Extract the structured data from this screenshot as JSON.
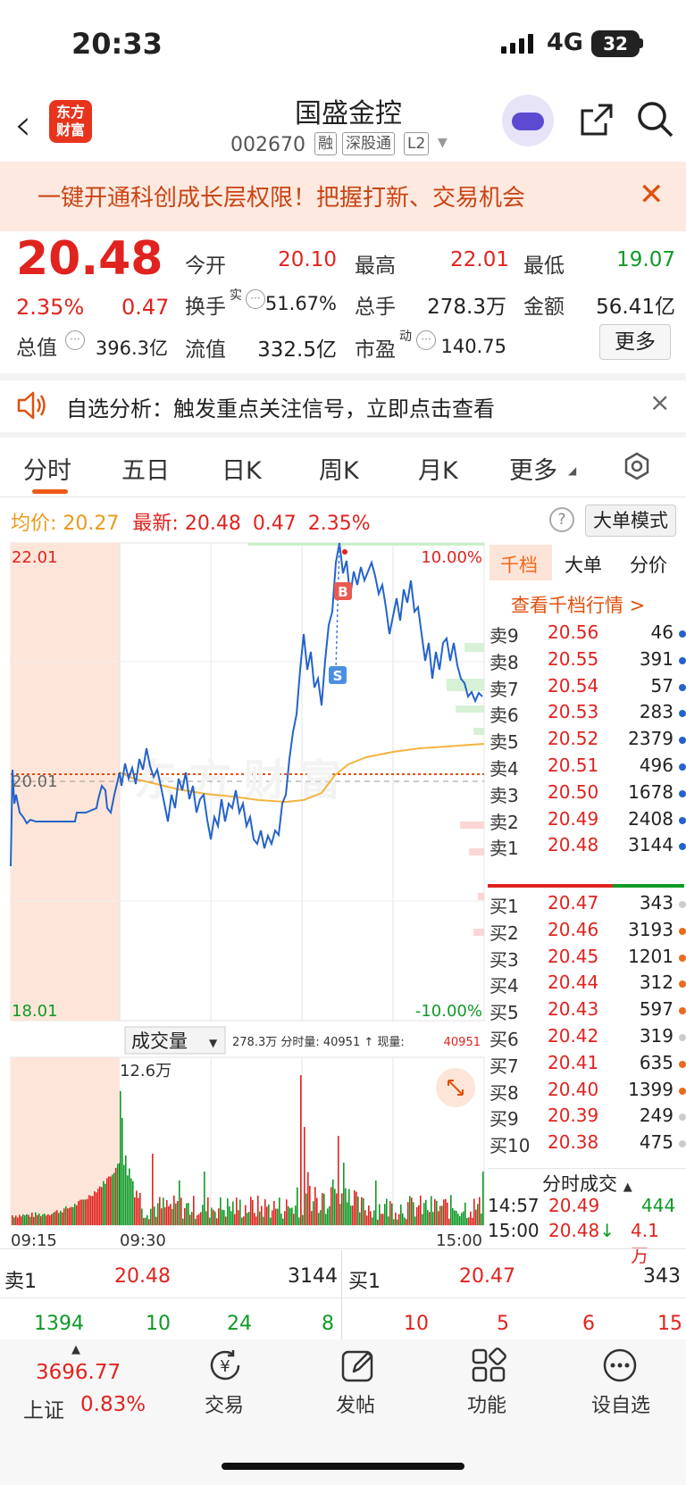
{
  "status": {
    "time": "20:33",
    "network": "4G",
    "battery": "32"
  },
  "header": {
    "logo_text_1": "东方",
    "logo_text_2": "财富",
    "name": "国盛金控",
    "code": "002670",
    "tags": [
      "融",
      "深股通",
      "L2"
    ]
  },
  "banner": {
    "text": "一键开通科创成长层权限！把握打新、交易机会"
  },
  "quote": {
    "price": "20.48",
    "pct": "2.35%",
    "change": "0.47",
    "open_label": "今开",
    "open": "20.10",
    "high_label": "最高",
    "high": "22.01",
    "low_label": "最低",
    "low": "19.07",
    "turnover_label": "换手",
    "turnover_sup": "实",
    "turnover": "51.67%",
    "volume_label": "总手",
    "volume": "278.3万",
    "amount_label": "金额",
    "amount": "56.41亿",
    "mktcap_label": "总值",
    "mktcap": "396.3亿",
    "float_label": "流值",
    "float": "332.5亿",
    "pe_label": "市盈",
    "pe_sup": "动",
    "pe": "140.75",
    "more_label": "更多"
  },
  "alert": {
    "text": "自选分析：触发重点关注信号，立即点击查看"
  },
  "tabs": [
    "分时",
    "五日",
    "日K",
    "周K",
    "月K",
    "更多"
  ],
  "chart_info": {
    "avg_label": "均价:",
    "avg": "20.27",
    "latest_label": "最新:",
    "latest": "20.48",
    "latest_change": "0.47",
    "latest_pct": "2.35%",
    "mode_button": "大单模式"
  },
  "chart_data": {
    "type": "line",
    "y_top": "22.01",
    "y_mid": "20.01",
    "y_bottom": "18.01",
    "pct_top": "10.00%",
    "pct_bottom": "-10.00%",
    "ylim": [
      18.01,
      22.01
    ],
    "markers": [
      "B",
      "S"
    ],
    "volume_selector": "成交量",
    "volume_info": "278.3万 分时量: 40951 ↑ 现量:",
    "volume_now": "40951",
    "volume_max": "12.6万",
    "x_labels": [
      "09:15",
      "09:30",
      "15:00"
    ]
  },
  "orderbook": {
    "tabs": [
      "千档",
      "大单",
      "分价"
    ],
    "link": "查看千档行情 >",
    "sells": [
      {
        "label": "卖9",
        "price": "20.56",
        "vol": "46",
        "dot": "#2563c9"
      },
      {
        "label": "卖8",
        "price": "20.55",
        "vol": "391",
        "dot": "#2563c9"
      },
      {
        "label": "卖7",
        "price": "20.54",
        "vol": "57",
        "dot": "#2563c9"
      },
      {
        "label": "卖6",
        "price": "20.53",
        "vol": "283",
        "dot": "#2563c9"
      },
      {
        "label": "卖5",
        "price": "20.52",
        "vol": "2379",
        "dot": "#2563c9"
      },
      {
        "label": "卖4",
        "price": "20.51",
        "vol": "496",
        "dot": "#2563c9"
      },
      {
        "label": "卖3",
        "price": "20.50",
        "vol": "1678",
        "dot": "#2563c9"
      },
      {
        "label": "卖2",
        "price": "20.49",
        "vol": "2408",
        "dot": "#2563c9"
      },
      {
        "label": "卖1",
        "price": "20.48",
        "vol": "3144",
        "dot": "#2563c9"
      }
    ],
    "buys": [
      {
        "label": "买1",
        "price": "20.47",
        "vol": "343",
        "dot": "#cccccc"
      },
      {
        "label": "买2",
        "price": "20.46",
        "vol": "3193",
        "dot": "#ee6a1c"
      },
      {
        "label": "买3",
        "price": "20.45",
        "vol": "1201",
        "dot": "#ee6a1c"
      },
      {
        "label": "买4",
        "price": "20.44",
        "vol": "312",
        "dot": "#ee6a1c"
      },
      {
        "label": "买5",
        "price": "20.43",
        "vol": "597",
        "dot": "#ee6a1c"
      },
      {
        "label": "买6",
        "price": "20.42",
        "vol": "319",
        "dot": "#cccccc"
      },
      {
        "label": "买7",
        "price": "20.41",
        "vol": "635",
        "dot": "#ee6a1c"
      },
      {
        "label": "买8",
        "price": "20.40",
        "vol": "1399",
        "dot": "#ee6a1c"
      },
      {
        "label": "买9",
        "price": "20.39",
        "vol": "249",
        "dot": "#cccccc"
      },
      {
        "label": "买10",
        "price": "20.38",
        "vol": "475",
        "dot": "#cccccc"
      }
    ],
    "ticks_title": "分时成交",
    "ticks": [
      {
        "time": "14:57",
        "price": "20.49",
        "vol": "444"
      },
      {
        "time": "15:00",
        "price": "20.48",
        "arrow": "↓",
        "vol": "4.1万"
      }
    ]
  },
  "bottom_quote": {
    "sell_label": "卖1",
    "sell_price": "20.48",
    "sell_vol": "3144",
    "buy_label": "买1",
    "buy_price": "20.47",
    "buy_vol": "343",
    "left_nums": [
      "1394",
      "10",
      "24",
      "8"
    ],
    "right_nums": [
      "10",
      "5",
      "6",
      "15"
    ]
  },
  "nav": {
    "index_value": "3696.77",
    "index_name": "上证",
    "index_pct": "0.83%",
    "items": [
      "交易",
      "发帖",
      "功能",
      "设自选"
    ]
  }
}
